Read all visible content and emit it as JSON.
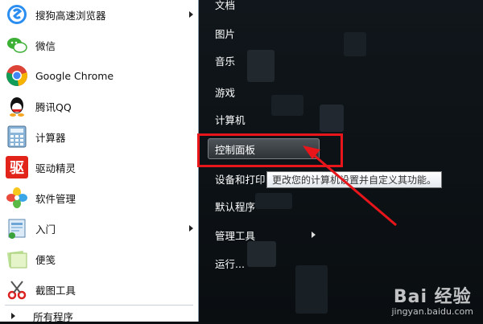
{
  "left_programs": [
    {
      "label": "搜狗高速浏览器",
      "icon": "sogou-browser-icon",
      "has_submenu": true
    },
    {
      "label": "微信",
      "icon": "wechat-icon",
      "has_submenu": false
    },
    {
      "label": "Google Chrome",
      "icon": "chrome-icon",
      "has_submenu": false
    },
    {
      "label": "腾讯QQ",
      "icon": "qq-icon",
      "has_submenu": false
    },
    {
      "label": "计算器",
      "icon": "calculator-icon",
      "has_submenu": false
    },
    {
      "label": "驱动精灵",
      "icon": "driver-genius-icon",
      "has_submenu": false,
      "icon_glyph": "驱"
    },
    {
      "label": "软件管理",
      "icon": "software-manager-icon",
      "has_submenu": false
    },
    {
      "label": "入门",
      "icon": "getting-started-icon",
      "has_submenu": true
    },
    {
      "label": "便笺",
      "icon": "sticky-notes-icon",
      "has_submenu": false
    },
    {
      "label": "截图工具",
      "icon": "snipping-tool-icon",
      "has_submenu": false
    }
  ],
  "all_programs_label": "所有程序",
  "right_items": [
    {
      "label": "文档"
    },
    {
      "label": "图片"
    },
    {
      "label": "音乐"
    },
    {
      "label": "游戏"
    },
    {
      "label": "计算机"
    },
    {
      "label": "控制面板",
      "highlighted": true
    },
    {
      "label": "设备和打印机"
    },
    {
      "label": "默认程序"
    },
    {
      "label": "管理工具",
      "has_submenu": true
    },
    {
      "label": "运行..."
    }
  ],
  "tooltip": "更改您的计算机设置并自定义其功能。",
  "watermark": {
    "brand": "Bai 经验",
    "url": "jingyan.baidu.com"
  },
  "colors": {
    "annotation_red": "#e8151b",
    "highlight_bg": "#3e4448",
    "pane_bg": "#0b0f12"
  }
}
